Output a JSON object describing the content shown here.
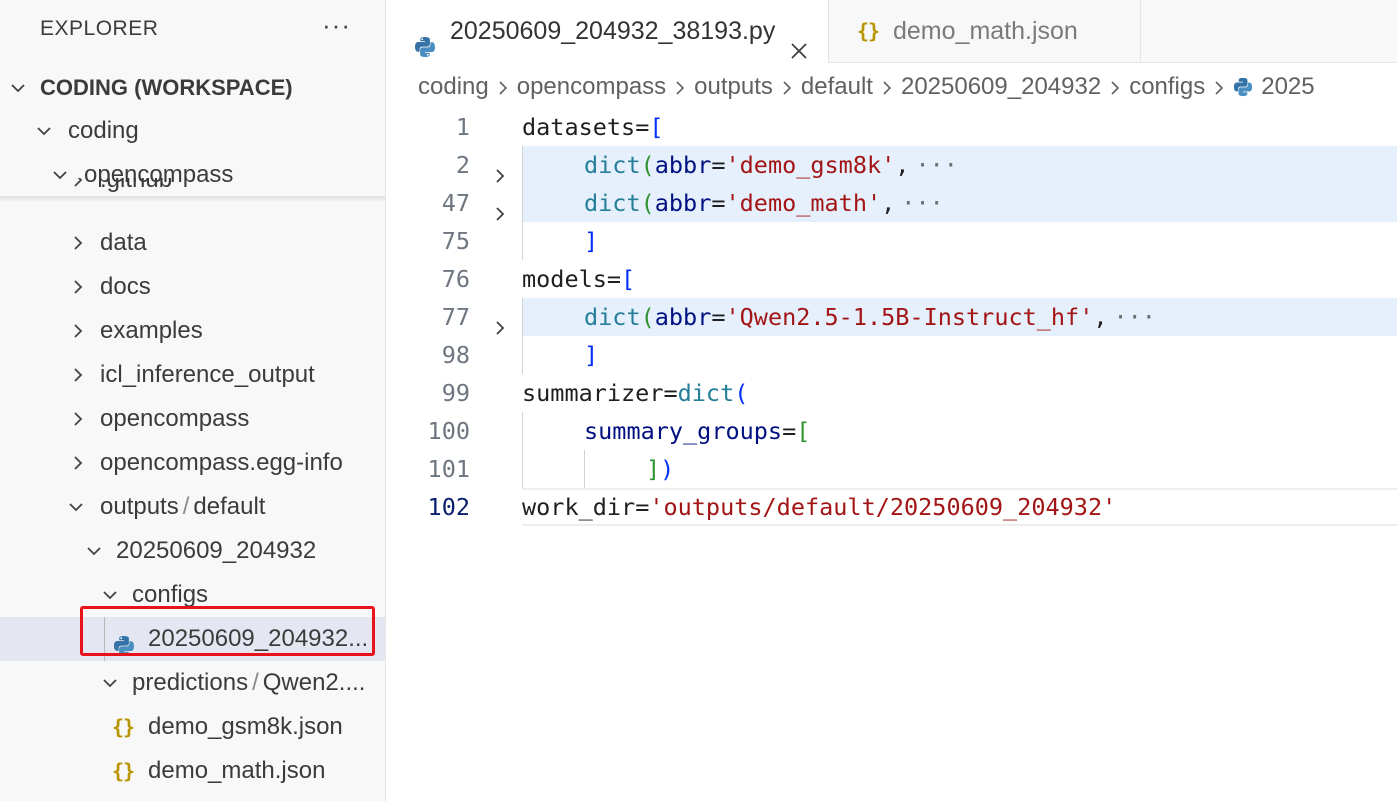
{
  "explorer": {
    "title": "EXPLORER",
    "more_label": "···",
    "workspace_label": "CODING (WORKSPACE)",
    "tree": [
      {
        "label": "coding",
        "expanded": true
      },
      {
        "label": "opencompass",
        "expanded": true
      },
      {
        "label": ".github",
        "expanded": false
      },
      {
        "label": "data",
        "expanded": false
      },
      {
        "label": "docs",
        "expanded": false
      },
      {
        "label": "examples",
        "expanded": false
      },
      {
        "label": "icl_inference_output",
        "expanded": false
      },
      {
        "label": "opencompass",
        "expanded": false
      },
      {
        "label": "opencompass.egg-info",
        "expanded": false
      },
      {
        "label": "outputs",
        "label2": "default",
        "separator": "/",
        "expanded": true
      },
      {
        "label": "20250609_204932",
        "expanded": true
      },
      {
        "label": "configs",
        "expanded": true
      },
      {
        "label": "20250609_204932...",
        "icon": "python-icon",
        "selected": true
      },
      {
        "label": "predictions",
        "label2": "Qwen2....",
        "separator": "/",
        "expanded": true
      },
      {
        "label": "demo_gsm8k.json",
        "icon": "json-icon"
      },
      {
        "label": "demo_math.json",
        "icon": "json-icon"
      }
    ]
  },
  "tabs": [
    {
      "label": "20250609_204932_38193.py",
      "icon": "python-icon",
      "active": true,
      "close": "✕"
    },
    {
      "label": "demo_math.json",
      "icon": "json-icon",
      "icon_text": "{}",
      "active": false
    }
  ],
  "breadcrumb": [
    "coding",
    "opencompass",
    "outputs",
    "default",
    "20250609_204932",
    "configs",
    "2025"
  ],
  "editor": {
    "lines": [
      {
        "n": "1",
        "tokens": [
          [
            "datasets",
            "plain"
          ],
          [
            "=",
            "plain"
          ],
          [
            "[",
            "b1"
          ]
        ]
      },
      {
        "n": "2",
        "fold": true,
        "folded": true,
        "tokens": [
          [
            "dict",
            "fn"
          ],
          [
            "(",
            "b2"
          ],
          [
            "abbr",
            "var"
          ],
          [
            "=",
            "plain"
          ],
          [
            "'demo_gsm8k'",
            "str"
          ],
          [
            ",",
            "plain"
          ],
          [
            "···",
            "ell"
          ]
        ]
      },
      {
        "n": "47",
        "fold": true,
        "folded": true,
        "tokens": [
          [
            "dict",
            "fn"
          ],
          [
            "(",
            "b2"
          ],
          [
            "abbr",
            "var"
          ],
          [
            "=",
            "plain"
          ],
          [
            "'demo_math'",
            "str"
          ],
          [
            ",",
            "plain"
          ],
          [
            "···",
            "ell"
          ]
        ]
      },
      {
        "n": "75",
        "tokens": [
          [
            "]",
            "b1"
          ]
        ]
      },
      {
        "n": "76",
        "tokens": [
          [
            "models",
            "plain"
          ],
          [
            "=",
            "plain"
          ],
          [
            "[",
            "b1"
          ]
        ]
      },
      {
        "n": "77",
        "fold": true,
        "folded": true,
        "tokens": [
          [
            "dict",
            "fn"
          ],
          [
            "(",
            "b2"
          ],
          [
            "abbr",
            "var"
          ],
          [
            "=",
            "plain"
          ],
          [
            "'Qwen2.5-1.5B-Instruct_hf'",
            "str"
          ],
          [
            ",",
            "plain"
          ],
          [
            "···",
            "ell"
          ]
        ]
      },
      {
        "n": "98",
        "tokens": [
          [
            "]",
            "b1"
          ]
        ]
      },
      {
        "n": "99",
        "tokens": [
          [
            "summarizer",
            "plain"
          ],
          [
            "=",
            "plain"
          ],
          [
            "dict",
            "fn"
          ],
          [
            "(",
            "b1"
          ]
        ]
      },
      {
        "n": "100",
        "tokens": [
          [
            "summary_groups",
            "var"
          ],
          [
            "=",
            "plain"
          ],
          [
            "[",
            "b2"
          ]
        ]
      },
      {
        "n": "101",
        "tokens": [
          [
            "]",
            "b2"
          ],
          [
            ")",
            "b1"
          ]
        ]
      },
      {
        "n": "102",
        "current": true,
        "tokens": [
          [
            "work_dir",
            "plain"
          ],
          [
            "=",
            "plain"
          ],
          [
            "'outputs/default/20250609_204932'",
            "str"
          ]
        ]
      }
    ]
  },
  "colors": {
    "selection_highlight": "#e8121b",
    "folded_line_bg": "#e5f0fc",
    "selected_row_bg": "#e4e6f1"
  }
}
